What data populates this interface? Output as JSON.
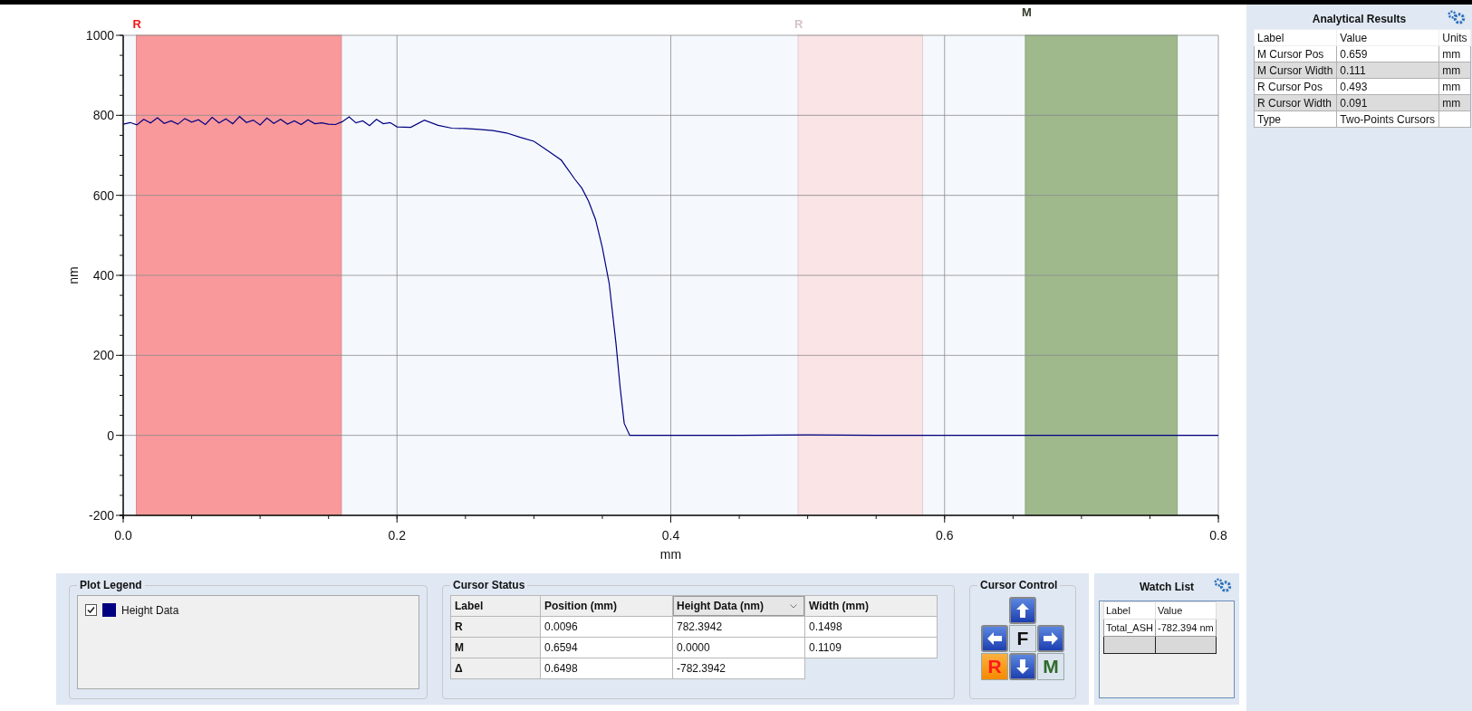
{
  "chart": {
    "chart_data": {
      "type": "line",
      "xlabel": "mm",
      "ylabel": "nm",
      "xlim": [
        0,
        0.8
      ],
      "ylim": [
        -200,
        1000
      ],
      "xticks": [
        {
          "value": 0,
          "label": "0.0"
        },
        {
          "value": 0.2,
          "label": "0.2"
        },
        {
          "value": 0.4,
          "label": "0.4"
        },
        {
          "value": 0.6,
          "label": "0.6"
        },
        {
          "value": 0.8,
          "label": "0.8"
        }
      ],
      "yticks": [
        -200,
        0,
        200,
        400,
        600,
        800,
        1000
      ],
      "x": [
        0,
        0.005,
        0.01,
        0.015,
        0.02,
        0.025,
        0.03,
        0.035,
        0.04,
        0.045,
        0.05,
        0.055,
        0.06,
        0.065,
        0.07,
        0.075,
        0.08,
        0.085,
        0.09,
        0.095,
        0.1,
        0.105,
        0.11,
        0.115,
        0.12,
        0.125,
        0.13,
        0.135,
        0.14,
        0.145,
        0.15,
        0.155,
        0.16,
        0.165,
        0.17,
        0.175,
        0.18,
        0.185,
        0.19,
        0.195,
        0.2,
        0.21,
        0.22,
        0.23,
        0.24,
        0.25,
        0.26,
        0.27,
        0.28,
        0.29,
        0.3,
        0.31,
        0.32,
        0.33,
        0.335,
        0.34,
        0.345,
        0.35,
        0.355,
        0.36,
        0.363,
        0.366,
        0.37,
        0.4,
        0.45,
        0.5,
        0.55,
        0.6,
        0.65,
        0.7,
        0.75,
        0.8
      ],
      "series": [
        {
          "name": "Height Data",
          "color": "#000080",
          "values": [
            778,
            782,
            776,
            790,
            781,
            794,
            780,
            786,
            778,
            792,
            783,
            789,
            777,
            795,
            781,
            791,
            779,
            797,
            782,
            788,
            776,
            793,
            780,
            790,
            778,
            786,
            777,
            789,
            779,
            781,
            778,
            777,
            784,
            796,
            781,
            786,
            774,
            790,
            779,
            782,
            771,
            770,
            788,
            775,
            768,
            767,
            765,
            762,
            756,
            745,
            735,
            712,
            688,
            640,
            618,
            585,
            540,
            470,
            380,
            230,
            120,
            30,
            0,
            0,
            0,
            1,
            0,
            0,
            0,
            0,
            0,
            0
          ]
        }
      ],
      "grid": true,
      "bands": [
        {
          "axis": "x",
          "label": "R",
          "from": 0.0096,
          "to": 0.1594,
          "color": "#f9999b"
        },
        {
          "axis": "x",
          "label": "R",
          "from": 0.493,
          "to": 0.584,
          "color": "#fbe4e6"
        },
        {
          "axis": "x",
          "label": "M",
          "from": 0.659,
          "to": 0.77,
          "color": "#9fb98c"
        }
      ]
    }
  },
  "plot_legend": {
    "title": "Plot Legend",
    "items": [
      {
        "checked": true
      }
    ]
  },
  "cursor_status": {
    "title": "Cursor Status",
    "columns": [
      {
        "label": "Label",
        "active": false
      },
      {
        "label": "Position (mm)",
        "active": false
      },
      {
        "label": "Height Data (nm)",
        "active": true
      },
      {
        "label": "Width (mm)",
        "active": false
      }
    ],
    "rows": [
      [
        "R",
        "0.0096",
        "782.3942",
        "0.1498"
      ],
      [
        "M",
        "0.6594",
        "0.0000",
        "0.1109"
      ],
      [
        "Δ",
        "0.6498",
        "-782.3942"
      ]
    ]
  },
  "cursor_control": {
    "title": "Cursor Control",
    "buttons": [
      {
        "kind": "up"
      },
      {
        "kind": "left"
      },
      {
        "kind": "text",
        "label": "F",
        "color": "#111111",
        "selected": false
      },
      {
        "kind": "right"
      },
      {
        "kind": "text",
        "label": "R",
        "color": "#ff1a1a",
        "selected": true
      },
      {
        "kind": "down"
      },
      {
        "kind": "text",
        "label": "M",
        "color": "#2f6b2a",
        "selected": false
      }
    ]
  },
  "watch_list": {
    "title": "Watch List",
    "columns": [
      "Label",
      "Value"
    ],
    "rows": [
      [
        "Total_ASH",
        "-782.394 nm"
      ]
    ]
  },
  "analytical_results": {
    "title": "Analytical Results",
    "columns": [
      "Label",
      "Value",
      "Units"
    ],
    "rows": [
      [
        "M Cursor Pos",
        "0.659",
        "mm"
      ],
      [
        "M Cursor Width",
        "0.111",
        "mm"
      ],
      [
        "R Cursor Pos",
        "0.493",
        "mm"
      ],
      [
        "R Cursor Width",
        "0.091",
        "mm"
      ],
      [
        "Type",
        "Two-Points Cursors",
        null
      ]
    ]
  }
}
